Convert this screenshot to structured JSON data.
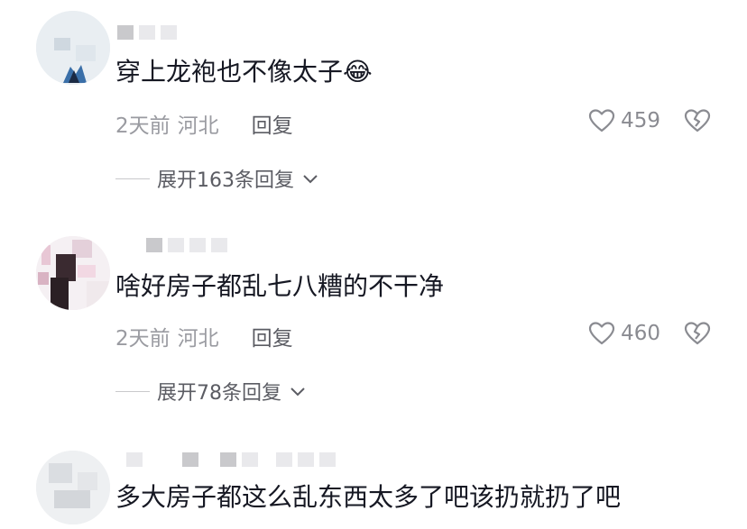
{
  "comments": [
    {
      "text": "穿上龙袍也不像太子",
      "emoji": "😂",
      "time": "2天前",
      "location": "河北",
      "reply_label": "回复",
      "likes": "459",
      "expand_label": "展开163条回复"
    },
    {
      "text": "啥好房子都乱七八糟的不干净",
      "time": "2天前",
      "location": "河北",
      "reply_label": "回复",
      "likes": "460",
      "expand_label": "展开78条回复"
    },
    {
      "text": "多大房子都这么乱东西太多了吧该扔就扔了吧"
    }
  ],
  "icons": {
    "like": "heart-outline-icon",
    "dislike": "broken-heart-icon",
    "expand": "chevron-down-icon"
  },
  "colors": {
    "primary_text": "#161823",
    "secondary_text": "#9a9ba1",
    "reply_text": "#5b5c63"
  }
}
